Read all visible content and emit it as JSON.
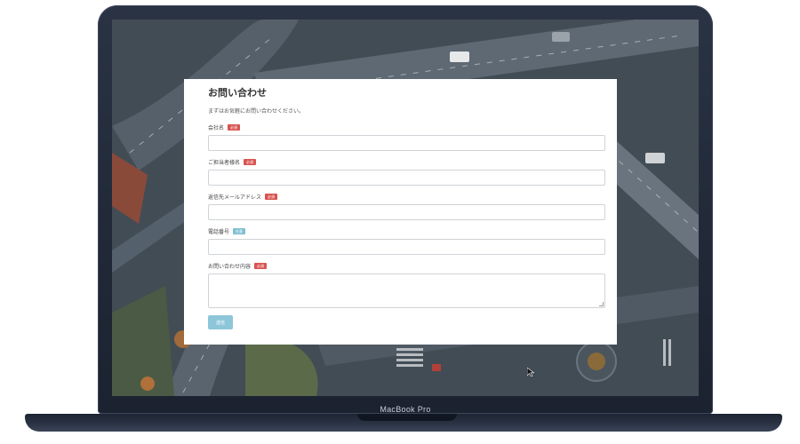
{
  "device": {
    "brand_label": "MacBook Pro"
  },
  "form": {
    "title": "お問い合わせ",
    "intro": "まずはお気軽にお問い合わせください。",
    "fields": [
      {
        "label": "会社名",
        "badge": "必須",
        "required": true,
        "value": ""
      },
      {
        "label": "ご担当者様名",
        "badge": "必須",
        "required": true,
        "value": ""
      },
      {
        "label": "返信先メールアドレス",
        "badge": "必須",
        "required": true,
        "value": ""
      },
      {
        "label": "電話番号",
        "badge": "任意",
        "required": false,
        "value": ""
      },
      {
        "label": "お問い合わせ内容",
        "badge": "必須",
        "required": true,
        "value": ""
      }
    ],
    "submit_label": "送信"
  },
  "colors": {
    "required_badge": "#d9534f",
    "optional_badge": "#7fbfd1",
    "submit_button": "#8ec6d9",
    "laptop_body": "#1b2230"
  }
}
